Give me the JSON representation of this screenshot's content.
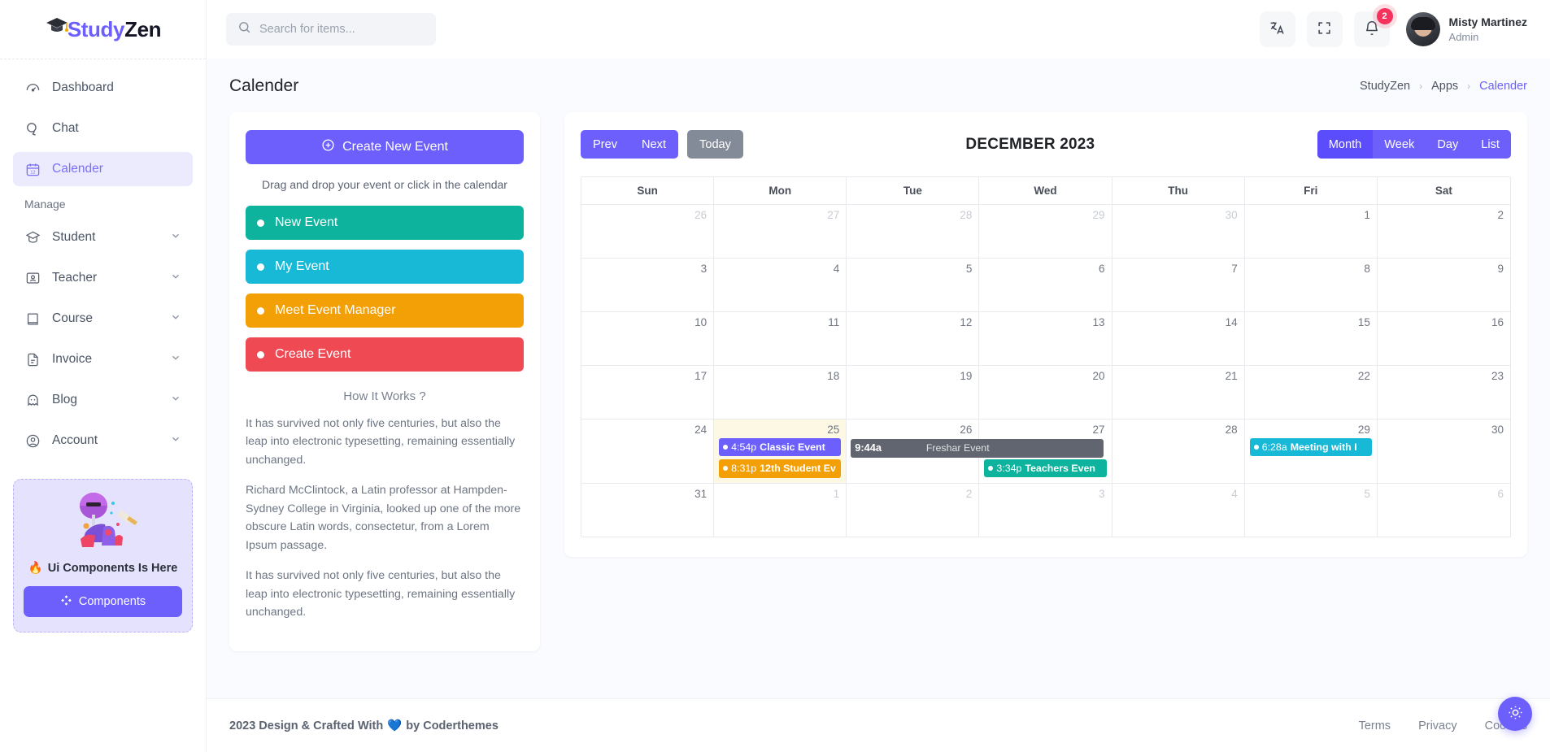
{
  "brand": {
    "part1": "Study",
    "part2": "Zen",
    "cap_icon": "graduation-cap-icon"
  },
  "sidebar": {
    "items": [
      {
        "label": "Dashboard",
        "icon": "gauge-icon",
        "active": false,
        "chevron": false
      },
      {
        "label": "Chat",
        "icon": "chat-bubbles-icon",
        "active": false,
        "chevron": false
      },
      {
        "label": "Calender",
        "icon": "calendar-icon",
        "active": true,
        "chevron": false
      }
    ],
    "section_label": "Manage",
    "manage_items": [
      {
        "label": "Student",
        "icon": "student-cap-icon",
        "chevron": true
      },
      {
        "label": "Teacher",
        "icon": "teacher-board-icon",
        "chevron": true
      },
      {
        "label": "Course",
        "icon": "book-icon",
        "chevron": true
      },
      {
        "label": "Invoice",
        "icon": "document-icon",
        "chevron": true
      },
      {
        "label": "Blog",
        "icon": "ghost-icon",
        "chevron": true
      },
      {
        "label": "Account",
        "icon": "user-circle-icon",
        "chevron": true
      }
    ],
    "promo": {
      "art_icon": "ui-components-illustration",
      "fire_emoji": "🔥",
      "title": "Ui Components Is Here",
      "button_label": "Components",
      "button_icon": "components-diamond-icon"
    }
  },
  "topbar": {
    "search": {
      "placeholder": "Search for items...",
      "value": "",
      "icon": "search-icon"
    },
    "language_icon": "translate-icon",
    "fullscreen_icon": "fullscreen-expand-icon",
    "notification_icon": "bell-icon",
    "notification_count": "2",
    "user": {
      "name": "Misty Martinez",
      "role": "Admin",
      "avatar": "user-avatar"
    }
  },
  "page": {
    "title": "Calender",
    "breadcrumb": [
      {
        "label": "StudyZen",
        "current": false
      },
      {
        "label": "Apps",
        "current": false
      },
      {
        "label": "Calender",
        "current": true
      }
    ],
    "breadcrumb_sep": "›"
  },
  "left_panel": {
    "create_button": {
      "label": "Create New Event",
      "icon": "plus-circle-icon"
    },
    "drag_hint": "Drag and drop your event or click in the calendar",
    "chips": [
      {
        "label": "New Event",
        "color": "#0eb39e"
      },
      {
        "label": "My Event",
        "color": "#17b9d6"
      },
      {
        "label": "Meet Event Manager",
        "color": "#f3a007"
      },
      {
        "label": "Create Event",
        "color": "#ef4a53"
      }
    ],
    "howto_title": "How It Works ?",
    "paragraphs": [
      "It has survived not only five centuries, but also the leap into electronic typesetting, remaining essentially unchanged.",
      "Richard McClintock, a Latin professor at Hampden-Sydney College in Virginia, looked up one of the more obscure Latin words, consectetur, from a Lorem Ipsum passage.",
      "It has survived not only five centuries, but also the leap into electronic typesetting, remaining essentially unchanged."
    ]
  },
  "calendar": {
    "toolbar": {
      "prev_label": "Prev",
      "next_label": "Next",
      "today_label": "Today",
      "title": "DECEMBER 2023",
      "views": [
        {
          "label": "Month",
          "active": true
        },
        {
          "label": "Week",
          "active": false
        },
        {
          "label": "Day",
          "active": false
        },
        {
          "label": "List",
          "active": false
        }
      ]
    },
    "day_headers": [
      "Sun",
      "Mon",
      "Tue",
      "Wed",
      "Thu",
      "Fri",
      "Sat"
    ],
    "weeks": [
      [
        {
          "day": "26",
          "other": true
        },
        {
          "day": "27",
          "other": true
        },
        {
          "day": "28",
          "other": true
        },
        {
          "day": "29",
          "other": true
        },
        {
          "day": "30",
          "other": true
        },
        {
          "day": "1",
          "other": false
        },
        {
          "day": "2",
          "other": false
        }
      ],
      [
        {
          "day": "3"
        },
        {
          "day": "4"
        },
        {
          "day": "5"
        },
        {
          "day": "6"
        },
        {
          "day": "7"
        },
        {
          "day": "8"
        },
        {
          "day": "9"
        }
      ],
      [
        {
          "day": "10"
        },
        {
          "day": "11"
        },
        {
          "day": "12"
        },
        {
          "day": "13"
        },
        {
          "day": "14"
        },
        {
          "day": "15"
        },
        {
          "day": "16"
        }
      ],
      [
        {
          "day": "17"
        },
        {
          "day": "18"
        },
        {
          "day": "19"
        },
        {
          "day": "20"
        },
        {
          "day": "21"
        },
        {
          "day": "22"
        },
        {
          "day": "23"
        }
      ],
      [
        {
          "day": "24"
        },
        {
          "day": "25",
          "today": true,
          "events": [
            {
              "time": "4:54p",
              "title": "Classic Event",
              "color": "#6c5ffc",
              "dot": true
            },
            {
              "time": "8:31p",
              "title": "12th Student Ev",
              "color": "#f3a007",
              "dot": true
            }
          ]
        },
        {
          "day": "26",
          "events": [
            {
              "time": "9:44a",
              "title": "Freshar Event",
              "color": "#61656f",
              "dot": false,
              "span": 2
            }
          ]
        },
        {
          "day": "27",
          "events": [
            {
              "time": "3:34p",
              "title": "Teachers Even",
              "color": "#0eb39e",
              "dot": true,
              "offsetTop": true
            }
          ]
        },
        {
          "day": "28"
        },
        {
          "day": "29",
          "events": [
            {
              "time": "6:28a",
              "title": "Meeting with I",
              "color": "#17b9d6",
              "dot": true
            }
          ]
        },
        {
          "day": "30"
        }
      ],
      [
        {
          "day": "31"
        },
        {
          "day": "1",
          "other": true
        },
        {
          "day": "2",
          "other": true
        },
        {
          "day": "3",
          "other": true
        },
        {
          "day": "4",
          "other": true
        },
        {
          "day": "5",
          "other": true
        },
        {
          "day": "6",
          "other": true
        }
      ]
    ]
  },
  "footer": {
    "copyright_before": "2023 Design & Crafted With",
    "heart": "💙",
    "copyright_after": "by Coderthemes",
    "links": [
      "Terms",
      "Privacy",
      "Cookies"
    ],
    "theme_toggle_icon": "sun-icon"
  },
  "colors": {
    "primary": "#6c5ffc",
    "today_bg": "#fcf8e3",
    "danger": "#f5325c"
  }
}
